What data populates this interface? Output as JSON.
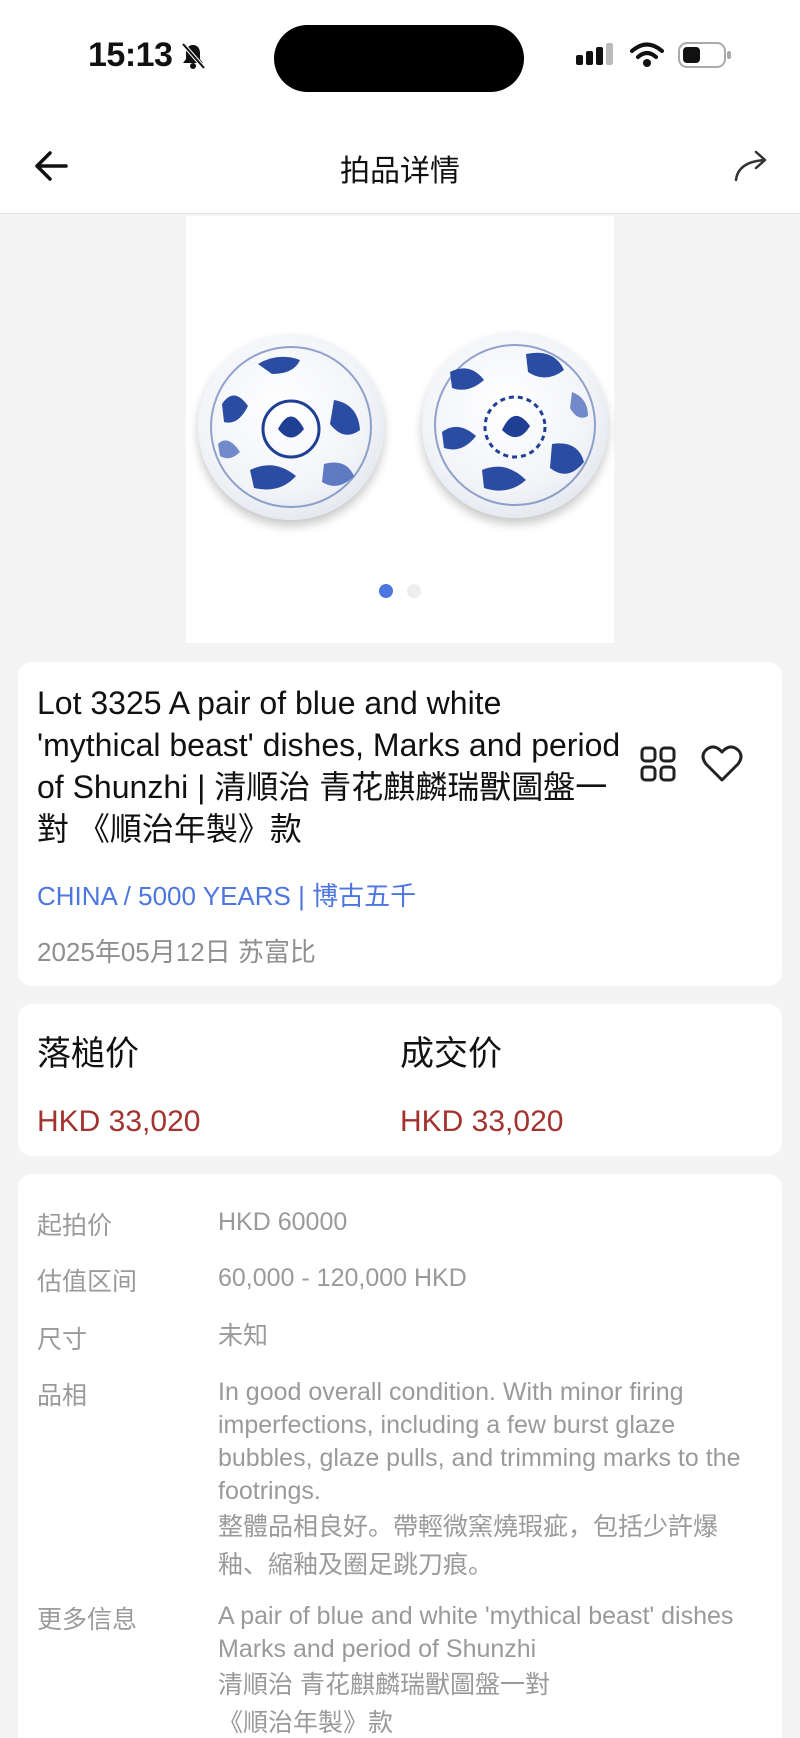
{
  "status_bar": {
    "time": "15:13"
  },
  "nav": {
    "title": "拍品详情"
  },
  "carousel": {
    "images": [
      "blue-and-white-dish-1",
      "blue-and-white-dish-2"
    ],
    "active_index": 0,
    "total": 2
  },
  "lot": {
    "title": "Lot 3325 A pair of blue and white 'mythical beast' dishes, Marks and period of Shunzhi | 清順治 青花麒麟瑞獸圖盤一對 《順治年製》款",
    "house": "CHINA / 5000 YEARS | 博古五千",
    "date": "2025年05月12日 苏富比"
  },
  "prices": {
    "hammer_label": "落槌价",
    "hammer_value": "HKD 33,020",
    "deal_label": "成交价",
    "deal_value": "HKD 33,020"
  },
  "details": {
    "start_label": "起拍价",
    "start_value": "HKD 60000",
    "estimate_label": "估值区间",
    "estimate_value": "60,000 - 120,000 HKD",
    "size_label": "尺寸",
    "size_value": "未知",
    "condition_label": "品相",
    "condition_en": "In good overall condition. With minor firing imperfections, including a few burst glaze bubbles, glaze pulls, and trimming marks to the footrings.",
    "condition_zh": "整體品相良好。帶輕微窯燒瑕疵，包括少許爆釉、縮釉及圈足跳刀痕。",
    "more_label": "更多信息",
    "more_line1": "A pair of blue and white 'mythical beast' dishes",
    "more_line2": "Marks and period of Shunzhi",
    "more_line3": "清順治 青花麒麟瑞獸圖盤一對",
    "more_line4": "《順治年製》款"
  },
  "colors": {
    "accent_blue": "#4d76e0",
    "price_red": "#a3332f",
    "muted_gray": "#9a9a9a",
    "page_bg": "#f4f4f5"
  }
}
